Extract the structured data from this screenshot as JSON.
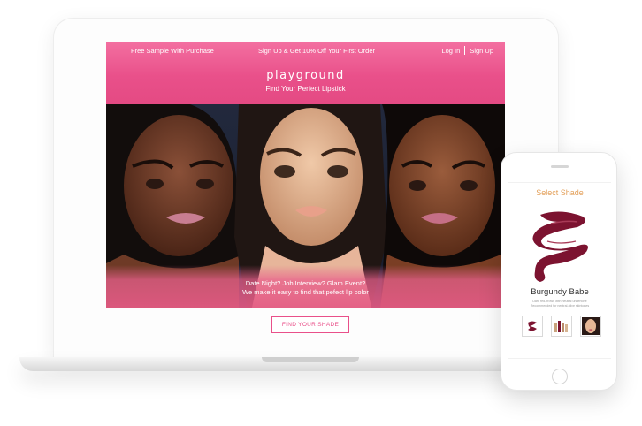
{
  "promo": {
    "left": "Free Sample With Purchase",
    "center": "Sign Up & Get 10% Off Your First Order",
    "login": "Log In",
    "signup": "Sign Up"
  },
  "brand": {
    "logo": "playground",
    "tagline": "Find Your Perfect Lipstick"
  },
  "hero": {
    "caption_line1": "Date Night? Job Interview? Glam Event?",
    "caption_line2": "We make it easy to find that pefect lip color"
  },
  "cta": {
    "label": "FIND YOUR SHADE"
  },
  "phone": {
    "title": "Select Shade",
    "shade_name": "Burgundy Babe",
    "shade_desc_line1": "Dark red-brown with neutral undertone",
    "shade_desc_line2": "Recommended for neutral-olive skintones",
    "thumbnails": [
      "lip-swatch-icon",
      "product-lineup-icon",
      "model-face-icon"
    ]
  },
  "colors": {
    "brand_pink": "#e9508a",
    "accent_gold": "#e3a05a",
    "burgundy": "#7c1330"
  }
}
